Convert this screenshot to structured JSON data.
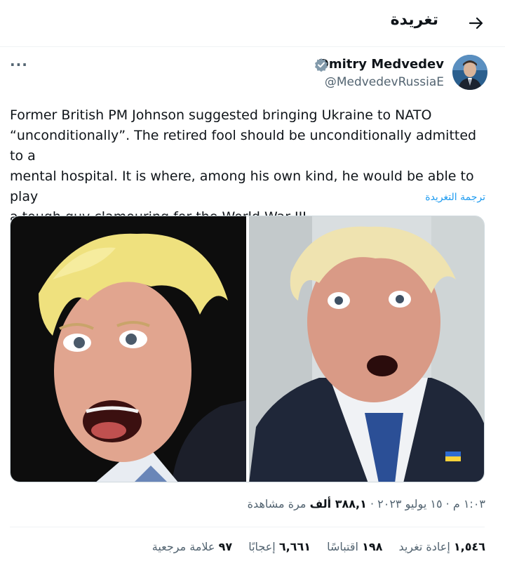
{
  "header": {
    "title": "تغريدة",
    "back_icon": "arrow-right-icon"
  },
  "author": {
    "name": "Dmitry Medvedev",
    "handle": "@MedvedevRussiaE",
    "verified_icon": "verified-badge-icon",
    "verified_color": "#829aab"
  },
  "more_label": "···",
  "tweet": {
    "text_lines": [
      "Former British PM Johnson suggested bringing Ukraine to NATO",
      "“unconditionally”. The retired fool should be unconditionally admitted to a",
      "mental hospital. It is where, among his own kind, he would be able to play",
      "a tough guy clamouring for the World War III."
    ],
    "translate_label": "ترجمة التغريدة"
  },
  "meta": {
    "time": "١:٠٣ م",
    "separator": "·",
    "date": "١٥ يوليو ٢٠٢٣",
    "views_number": "٣٨٨,١ ألف",
    "views_label": "مرة مشاهدة"
  },
  "stats": {
    "retweets_number": "١,٥٤٦",
    "retweets_label": "إعادة تغريد",
    "quotes_number": "١٩٨",
    "quotes_label": "اقتباسًا",
    "likes_number": "٦,٦٦١",
    "likes_label": "إعجابًا",
    "bookmarks_number": "٩٧",
    "bookmarks_label": "علامة مرجعية"
  },
  "colors": {
    "link": "#1d9bf0",
    "muted": "#536471",
    "text": "#0f1419"
  }
}
